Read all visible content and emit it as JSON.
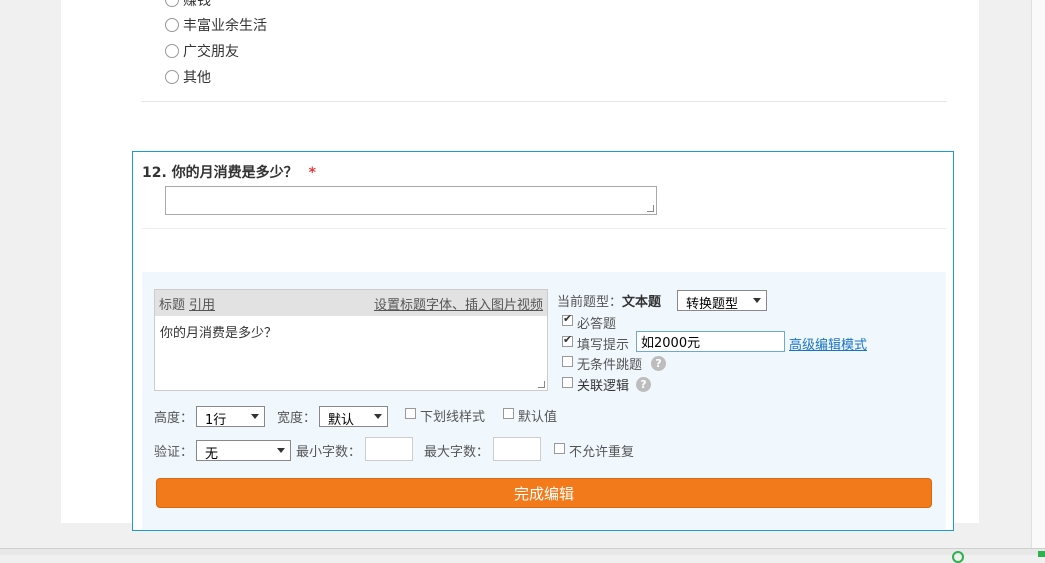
{
  "previous_question": {
    "options": [
      "赚钱",
      "丰富业余生活",
      "广交朋友",
      "其他"
    ]
  },
  "question": {
    "number": "12.",
    "title": "你的月消费是多少？",
    "required_mark": "*"
  },
  "editor": {
    "title_label": "标题",
    "cite_label": "引用",
    "font_link": "设置标题字体、插入图片视频",
    "title_text": "你的月消费是多少？",
    "type_label": "当前题型：",
    "type_value": "文本题",
    "convert_select": "转换题型",
    "required_label": "必答题",
    "required_checked": true,
    "hint_label": "填写提示",
    "hint_checked": true,
    "hint_value": "如2000元",
    "advanced_link": "高级编辑模式",
    "no_condition_label": "无条件跳题",
    "logic_label": "关联逻辑",
    "help_glyph": "?",
    "height_label": "高度：",
    "height_value": "1行",
    "width_label": "宽度：",
    "width_value": "默认",
    "underline_label": "下划线样式",
    "default_label": "默认值",
    "validate_label": "验证：",
    "validate_value": "无",
    "min_label": "最小字数：",
    "max_label": "最大字数：",
    "no_repeat_label": "不允许重复",
    "done_button": "完成编辑"
  }
}
